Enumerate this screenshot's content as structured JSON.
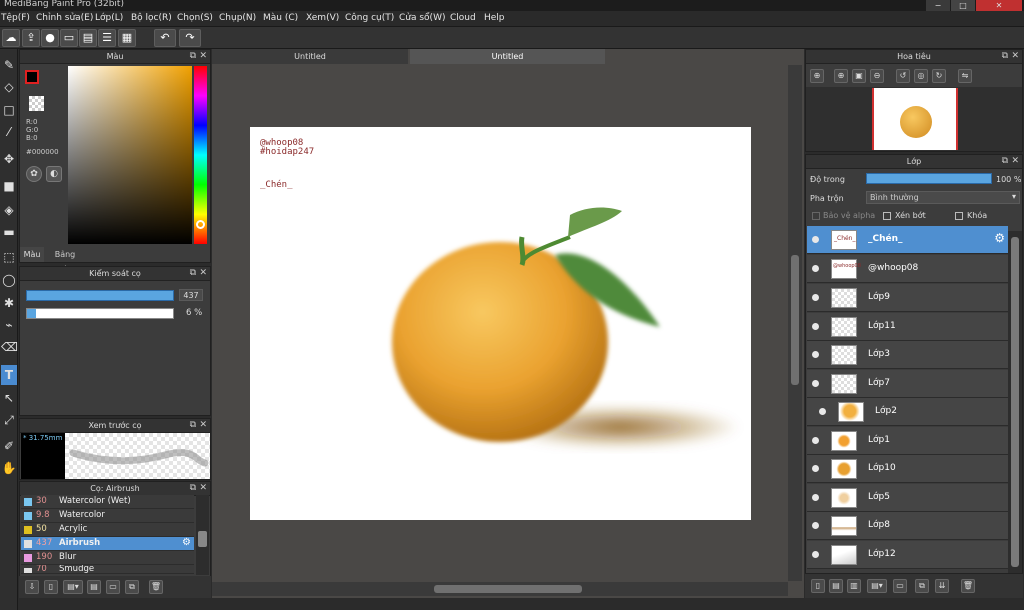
{
  "window": {
    "title": "MediBang Paint Pro (32bit)",
    "min": "−",
    "max": "□",
    "close": "✕"
  },
  "menu": [
    "Tệp(F)",
    "Chỉnh sửa(E)",
    "Lớp(L)",
    "Bộ lọc(R)",
    "Chọn(S)",
    "Chụp(N)",
    "Màu (C)",
    "Xem(V)",
    "Công cụ(T)",
    "Cửa sổ(W)",
    "Cloud",
    "Help"
  ],
  "toolbar": {
    "icons": [
      "cloud-icon",
      "share-icon",
      "comment-icon",
      "chat-icon",
      "document-icon",
      "list-icon",
      "grid-icon"
    ],
    "undo": "↶",
    "redo": "↷"
  },
  "tools": [
    "brush-icon",
    "eraser-icon",
    "rectangle-icon",
    "dot-brush-icon",
    "move-icon",
    "fill-rect-icon",
    "bucket-icon",
    "gradient-icon",
    "select-rect-icon",
    "lasso-icon",
    "magic-wand-icon",
    "select-pen-icon",
    "select-eraser-icon",
    "text-icon",
    "operation-icon",
    "eyedropper-icon",
    "pen-icon",
    "hand-icon"
  ],
  "color_panel": {
    "title": "Màu",
    "r": "R:0",
    "g": "G:0",
    "b": "B:0",
    "hex": "#000000",
    "tab_color": "Màu",
    "tab_palette": "Bảng màu",
    "primary": "#000000",
    "accent": "#e02020"
  },
  "brush_control": {
    "title": "Kiểm soát cọ",
    "size": "437",
    "opacity": "6 %",
    "opacity_fraction": 0.06
  },
  "brush_preview": {
    "title": "Xem trước cọ",
    "size_label": "* 31.75mm"
  },
  "brush_list": {
    "title": "Cọ: Airbrush",
    "items": [
      {
        "size": "30",
        "name": "Watercolor (Wet)",
        "color": "#7ac7f0"
      },
      {
        "size": "9.8",
        "name": "Watercolor",
        "color": "#7ac7f0"
      },
      {
        "size": "50",
        "name": "Acrylic",
        "color": "#e0c020"
      },
      {
        "size": "437",
        "name": "Airbrush",
        "color": "#e0e0e0"
      },
      {
        "size": "190",
        "name": "Blur",
        "color": "#e89ae0"
      },
      {
        "size": "70",
        "name": "Smudge",
        "color": "#e0e0e0"
      }
    ]
  },
  "tabs": [
    "Untitled",
    "Untitled"
  ],
  "canvas": {
    "line1": "@whoop08",
    "line2": "#hoidap247",
    "line3": "_Chén_"
  },
  "navigator": {
    "title": "Hoa tiêu"
  },
  "layer_panel": {
    "title": "Lớp",
    "opacity_label": "Độ trong",
    "opacity_value": "100 %",
    "blend_label": "Pha trộn",
    "blend_value": "Bình thường",
    "protect_alpha": "Bảo vệ alpha",
    "clip": "Xén bớt",
    "lock": "Khóa",
    "layers": [
      {
        "name": "_Chén_",
        "selected": true
      },
      {
        "name": "@whoop08"
      },
      {
        "name": "Lớp9"
      },
      {
        "name": "Lớp11"
      },
      {
        "name": "Lớp3"
      },
      {
        "name": "Lớp7"
      },
      {
        "name": "Lớp2",
        "indent": true
      },
      {
        "name": "Lớp1"
      },
      {
        "name": "Lớp10"
      },
      {
        "name": "Lớp5"
      },
      {
        "name": "Lớp8"
      },
      {
        "name": "Lớp12"
      }
    ]
  }
}
